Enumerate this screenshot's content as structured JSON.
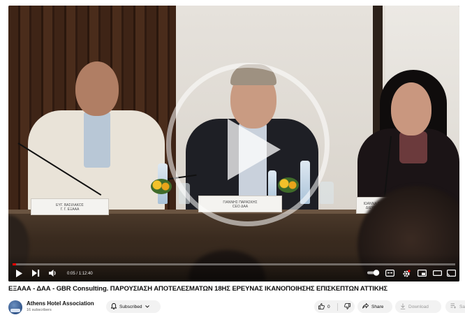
{
  "video": {
    "title": "ΕΞΑΑΑ - ΔΑΑ - GBR Consulting. ΠΑΡΟΥΣΙΑΣΗ ΑΠΟΤΕΛΕΣΜΑΤΩΝ 18ΗΣ ΕΡΕΥΝΑΣ ΙΚΑΝΟΠΟΙΗΣΗΣ ΕΠΙΣΚΕΠΤΩΝ ΑΤΤΙΚΗΣ",
    "placards": {
      "left_line1": "ΕΥΓ. ΒΑΣΙΛΑΚΟΣ",
      "left_line2": "Γ. Γ. ΕΞΑΑΑ",
      "center_line1": "ΓΙΑΝΝΗΣ ΠΑΡΑΣΚΗΣ",
      "center_line2": "CEO ΔΑΑ",
      "right_line1": "ΙΩΑΝΝΑ ΠΑΠ...",
      "right_line2": "ΔΙΕΥΘΥΝΤ..."
    }
  },
  "player": {
    "time_current": "0:05",
    "time_total": "1:12:40",
    "time_separator": " / ",
    "progress_fraction": 0.0012,
    "accent": "#ff0000",
    "icons": {
      "play": "play-icon",
      "next": "next-icon",
      "volume": "volume-icon",
      "autoplay": "autoplay-toggle-icon",
      "subtitles": "subtitles-icon",
      "settings": "settings-gear-icon",
      "miniplayer": "miniplayer-icon",
      "theater": "theater-mode-icon",
      "cast": "cast-icon"
    }
  },
  "channel": {
    "name": "Athens Hotel Association",
    "subscribers": "16 subscribers"
  },
  "actions": {
    "subscribe_label": "Subscribed",
    "like_count": "0",
    "share_label": "Share",
    "download_label": "Download",
    "save_label": "Sa"
  }
}
